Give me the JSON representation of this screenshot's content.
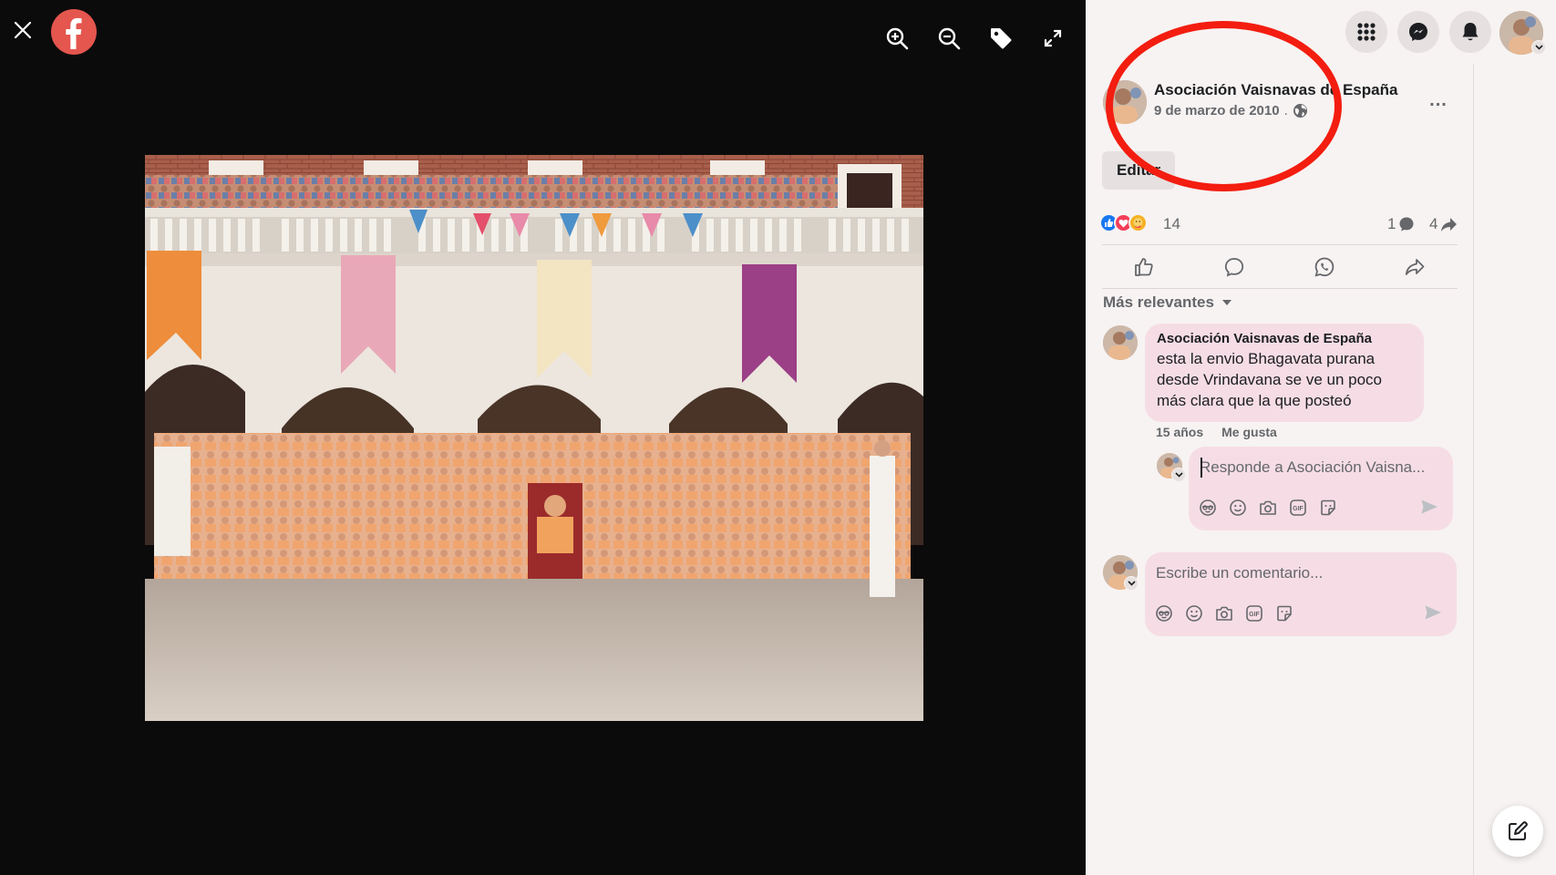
{
  "viewer": {
    "close_icon": "close-icon",
    "logo_icon": "facebook-logo-icon",
    "tools": [
      {
        "name": "zoom-in-icon"
      },
      {
        "name": "zoom-out-icon"
      },
      {
        "name": "tag-icon"
      },
      {
        "name": "fullscreen-icon"
      }
    ]
  },
  "header": {
    "icons": [
      "apps-grid-icon",
      "messenger-icon",
      "bell-icon",
      "profile-avatar"
    ]
  },
  "post": {
    "author": "Asociación Vaisnavas de España",
    "date": "9 de marzo de 2010",
    "date_separator": ".",
    "privacy_icon": "globe-icon",
    "more_label": "...",
    "edit_label": "Editar",
    "reactions": {
      "icons": [
        "like-reaction-icon",
        "love-reaction-icon",
        "care-reaction-icon"
      ],
      "count": "14"
    },
    "comment_count": "1",
    "share_count": "4",
    "actions": [
      "like-icon",
      "comment-icon",
      "whatsapp-icon",
      "share-icon"
    ]
  },
  "comments": {
    "sort_label": "Más relevantes",
    "items": [
      {
        "author": "Asociación Vaisnavas de España",
        "text": "esta la envio Bhagavata purana desde Vrindavana se ve un poco más clara que la que posteó",
        "time": "15 años",
        "like_label": "Me gusta"
      }
    ],
    "reply_placeholder": "Responde a Asociación Vaisna...",
    "new_comment_placeholder": "Escribe un comentario...",
    "tool_icons": [
      "avatar-sticker-icon",
      "emoji-icon",
      "camera-icon",
      "gif-icon",
      "sticker-icon"
    ],
    "send_icon": "send-icon"
  },
  "colors": {
    "viewer_bg": "#0c0b0b",
    "panel_bg": "#f7f3f2",
    "bubble_bg": "#f6dde5",
    "annotation_red": "#f31d10",
    "facebook_red": "#e4564e"
  }
}
